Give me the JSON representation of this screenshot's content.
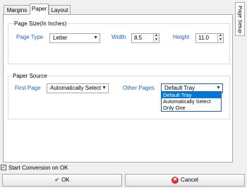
{
  "tabs": [
    "Margins",
    "Paper",
    "Layout"
  ],
  "side_tab": "Page Setup",
  "paper_size": {
    "title": "Page Size(In Inches)",
    "page_type_label": "Page Type",
    "page_type_value": "Letter",
    "width_label": "Width",
    "width_value": "8.5",
    "height_label": "Height",
    "height_value": "11.0"
  },
  "paper_source": {
    "title": "Paper Source",
    "first_page_label": "First Page",
    "first_page_value": "Automatically Select",
    "other_pages_label": "Other Pages",
    "other_pages_value": "Default Tray",
    "options": [
      "Default Tray",
      "Automatically Select",
      "Only One"
    ]
  },
  "footer": {
    "checkbox_label": "Start Conversion on OK",
    "checkbox_checked": true,
    "ok_label": "OK",
    "cancel_label": "Cancel"
  },
  "colors": {
    "label_blue": "#1b63c9",
    "selection": "#0078d7",
    "ok_icon": "#3a9a2a",
    "cancel_icon": "#d32f2f"
  },
  "icons": [
    "ok-check-icon",
    "cancel-x-icon",
    "caret-down-icon",
    "spin-up-icon",
    "spin-down-icon"
  ]
}
